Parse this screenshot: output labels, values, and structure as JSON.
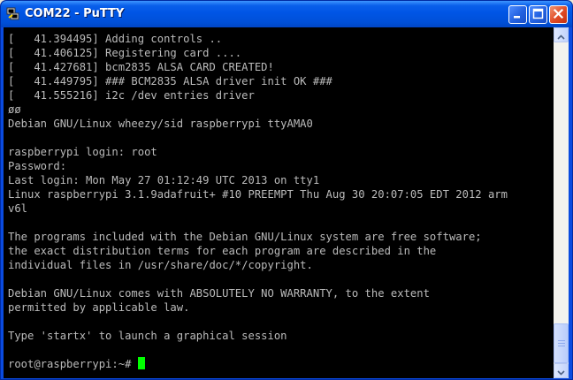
{
  "window": {
    "title": "COM22 - PuTTY",
    "app_icon": "putty-icon",
    "controls": [
      "minimize-icon",
      "maximize-icon",
      "close-icon"
    ]
  },
  "terminal": {
    "lines": [
      "[   41.394495] Adding controls ..",
      "[   41.406125] Registering card ....",
      "[   41.427681] bcm2835 ALSA CARD CREATED!",
      "[   41.449795] ### BCM2835 ALSA driver init OK ###",
      "[   41.555216] i2c /dev entries driver",
      "øø",
      "Debian GNU/Linux wheezy/sid raspberrypi ttyAMA0",
      "",
      "raspberrypi login: root",
      "Password:",
      "Last login: Mon May 27 01:12:49 UTC 2013 on tty1",
      "Linux raspberrypi 3.1.9adafruit+ #10 PREEMPT Thu Aug 30 20:07:05 EDT 2012 arm",
      "v6l",
      "",
      "The programs included with the Debian GNU/Linux system are free software;",
      "the exact distribution terms for each program are described in the",
      "individual files in /usr/share/doc/*/copyright.",
      "",
      "Debian GNU/Linux comes with ABSOLUTELY NO WARRANTY, to the extent",
      "permitted by applicable law.",
      "",
      "Type 'startx' to launch a graphical session",
      ""
    ],
    "prompt": "root@raspberrypi:~# ",
    "colors": {
      "background": "#000000",
      "text": "#bbbbbb",
      "cursor": "#00ff00"
    }
  },
  "scrollbar": {
    "position_fraction": 0.95
  }
}
